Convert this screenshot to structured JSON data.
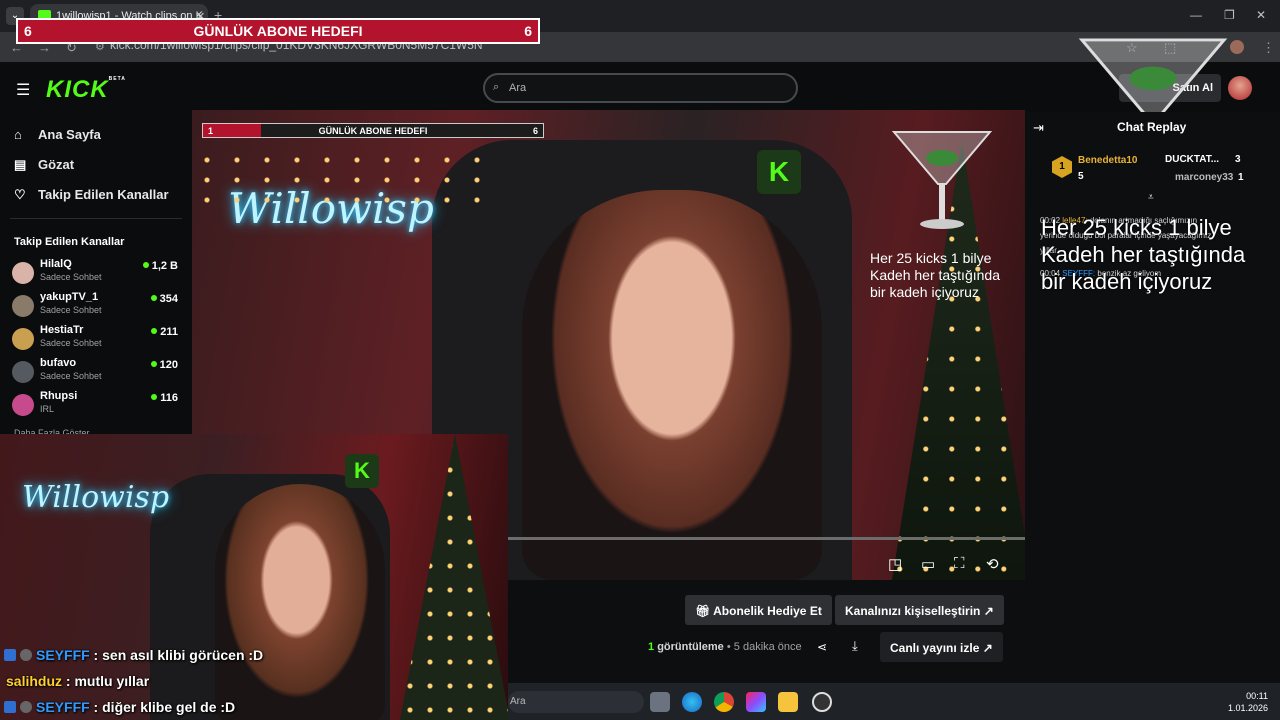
{
  "browser": {
    "tab_title": "1willowisp1 - Watch clips on K",
    "url": "kick.com/1willowisp1/clips/clip_01KDV3KN6JXGRWB0N5M57C1W5N"
  },
  "goal_banner": {
    "left": "6",
    "title": "GÜNLÜK ABONE HEDEFI",
    "right": "6"
  },
  "goal_banner_small": {
    "left": "1",
    "title": "GÜNLÜK ABONE HEDEFI",
    "right": "6",
    "progress": 0.17
  },
  "header": {
    "logo": "KICK",
    "logo_badge": "BETA",
    "search_placeholder": "Ara",
    "buy_label": "Satın Al"
  },
  "sidebar": {
    "nav": [
      {
        "label": "Ana Sayfa",
        "icon": "home-icon"
      },
      {
        "label": "Gözat",
        "icon": "browse-icon"
      },
      {
        "label": "Takip Edilen Kanallar",
        "icon": "heart-icon"
      }
    ],
    "section_title": "Takip Edilen Kanallar",
    "channels": [
      {
        "name": "HilalQ",
        "status": "Sadece Sohbet",
        "viewers": "1,2 B",
        "color": "#d9b3a8"
      },
      {
        "name": "yakupTV_1",
        "status": "Sadece Sohbet",
        "viewers": "354",
        "color": "#8a7a6a"
      },
      {
        "name": "HestiaTr",
        "status": "Sadece Sohbet",
        "viewers": "211",
        "color": "#c9a04f"
      },
      {
        "name": "bufavo",
        "status": "Sadece Sohbet",
        "viewers": "120",
        "color": "#555a60"
      },
      {
        "name": "Rhupsi",
        "status": "IRL",
        "viewers": "116",
        "color": "#c74b8c"
      }
    ],
    "show_more": "Daha Fazla Göster"
  },
  "stream_overlay": {
    "neon_text": "Willowisp",
    "kick_goal_text": [
      "Her 25 kicks 1 bilye",
      "Kadeh her taştığında",
      "bir kadeh içiyoruz"
    ]
  },
  "player_controls": [
    "pip-icon",
    "theater-icon",
    "fullscreen-icon",
    "replay-icon"
  ],
  "actions": {
    "gift_sub": "Abonelik Hediye Et",
    "customize": "Kanalınızı kişiselleştirin",
    "watch_live": "Canlı yayını izle",
    "views_count": "1",
    "views_label": "görüntüleme",
    "time_ago": "5 dakika önce"
  },
  "chat_replay": {
    "title": "Chat Replay",
    "leaders": [
      {
        "rank": "1",
        "name": "Benedetta10",
        "count": "5"
      },
      {
        "name": "DUCKTAT...",
        "count": "3"
      },
      {
        "name": "marconey33",
        "count": "1"
      }
    ],
    "messages": [
      {
        "time": "00:02",
        "user": "lelle47:",
        "text": "dolanın artmadığı saçlığımızın"
      },
      {
        "text": "yerinde olduğu bol paralar içinde yaşayacağımız"
      },
      {
        "text": "yıllar"
      },
      {
        "time": "00:04",
        "user": "SEYFFF:",
        "text": "benzik az geliyom"
      }
    ]
  },
  "overlay_chat": [
    {
      "user": "SEYFFF",
      "text": "sen asıl klibi görücen :D",
      "user_color": "#2f9bff"
    },
    {
      "user": "salihduz",
      "text": "mutlu yıllar",
      "user_color": "#ffcf33"
    },
    {
      "user": "SEYFFF",
      "text": "diğer klibe gel de :D",
      "user_color": "#2f9bff"
    }
  ],
  "taskbar": {
    "search": "Ara",
    "time": "00:11",
    "date": "1.01.2026"
  },
  "colors": {
    "kick_green": "#53fc18",
    "goal_red": "#b3132c"
  }
}
